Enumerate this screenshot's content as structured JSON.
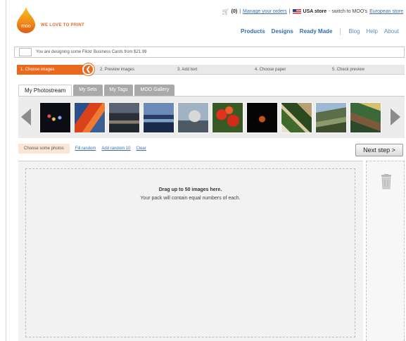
{
  "header": {
    "logo_text": "WE LOVE TO PRINT",
    "logo_mark": "moo",
    "cart_count": "(0)",
    "manage_orders": "Manage your orders",
    "store_name": "USA store",
    "switch_text": "- switch to MOO's",
    "european_store": "European store"
  },
  "nav": {
    "items": [
      "Products",
      "Designs",
      "Ready Made"
    ],
    "secondary": [
      "Blog",
      "Help",
      "About"
    ]
  },
  "notice": {
    "text": "You are designing some Flickr Business Cards from $21.99"
  },
  "steps": [
    "1. Choose images",
    "2. Preview images",
    "3. Add text",
    "4. Choose paper",
    "5. Check preview"
  ],
  "step_badge": "",
  "tabs": [
    "My Photostream",
    "My Sets",
    "My Tags",
    "MOO Gallery"
  ],
  "actions": {
    "choose": "Choose some photos",
    "fill_random": "Fill random",
    "add_random": "Add random 10",
    "clear": "Clear",
    "next_step": "Next step >"
  },
  "dropzone": {
    "title": "Drag up to 50 images here.",
    "subtitle": "Your pack will contain equal numbers of each."
  },
  "colors": {
    "accent": "#e86a1f",
    "link": "#3a6ea5"
  }
}
